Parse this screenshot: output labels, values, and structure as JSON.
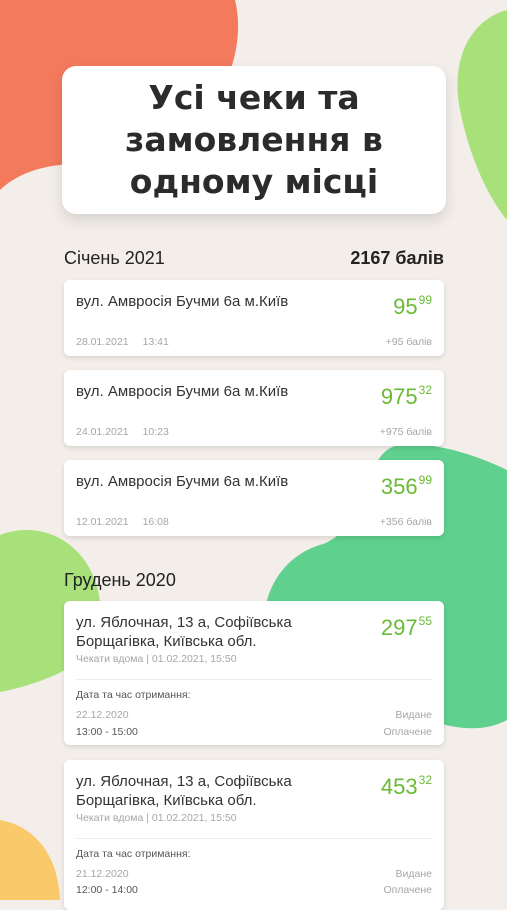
{
  "hero": {
    "title": "Усі чеки та замовлення в одному місці"
  },
  "sections": [
    {
      "month": "Січень 2021",
      "points": "2167 балів",
      "receipts": [
        {
          "address": "вул. Амвросія Бучми 6а м.Київ",
          "amount_main": "95",
          "amount_cents": "99",
          "date": "28.01.2021",
          "time": "13:41",
          "bonus": "+95 балів"
        },
        {
          "address": "вул. Амвросія Бучми 6а м.Київ",
          "amount_main": "975",
          "amount_cents": "32",
          "date": "24.01.2021",
          "time": "10:23",
          "bonus": "+975 балів"
        },
        {
          "address": "вул. Амвросія Бучми 6а м.Київ",
          "amount_main": "356",
          "amount_cents": "99",
          "date": "12.01.2021",
          "time": "16:08",
          "bonus": "+356 балів"
        }
      ]
    },
    {
      "month": "Грудень 2020",
      "orders": [
        {
          "address": "ул. Яблочная, 13 а, Софіївська Борщагівка, Київська обл.",
          "amount_main": "297",
          "amount_cents": "55",
          "delivery": "Чекати вдома | 01.02.2021, 15:50",
          "receive_label": "Дата та час отримання:",
          "receive_date": "22.12.2020",
          "receive_time": "13:00 - 15:00",
          "status1": "Видане",
          "status2": "Оплачене"
        },
        {
          "address": "ул. Яблочная, 13 а, Софіївська Борщагівка, Київська обл.",
          "amount_main": "453",
          "amount_cents": "32",
          "delivery": "Чекати вдома | 01.02.2021, 15:50",
          "receive_label": "Дата та час отримання:",
          "receive_date": "21.12.2020",
          "receive_time": "12:00 - 14:00",
          "status1": "Видане",
          "status2": "Оплачене"
        }
      ]
    }
  ],
  "colors": {
    "accent_green": "#6aba36",
    "blob_orange": "#f47a5e",
    "blob_lightgreen": "#a8e07a",
    "blob_green": "#5fd08d",
    "blob_yellow": "#f9c96a",
    "background": "#f3eeea"
  }
}
